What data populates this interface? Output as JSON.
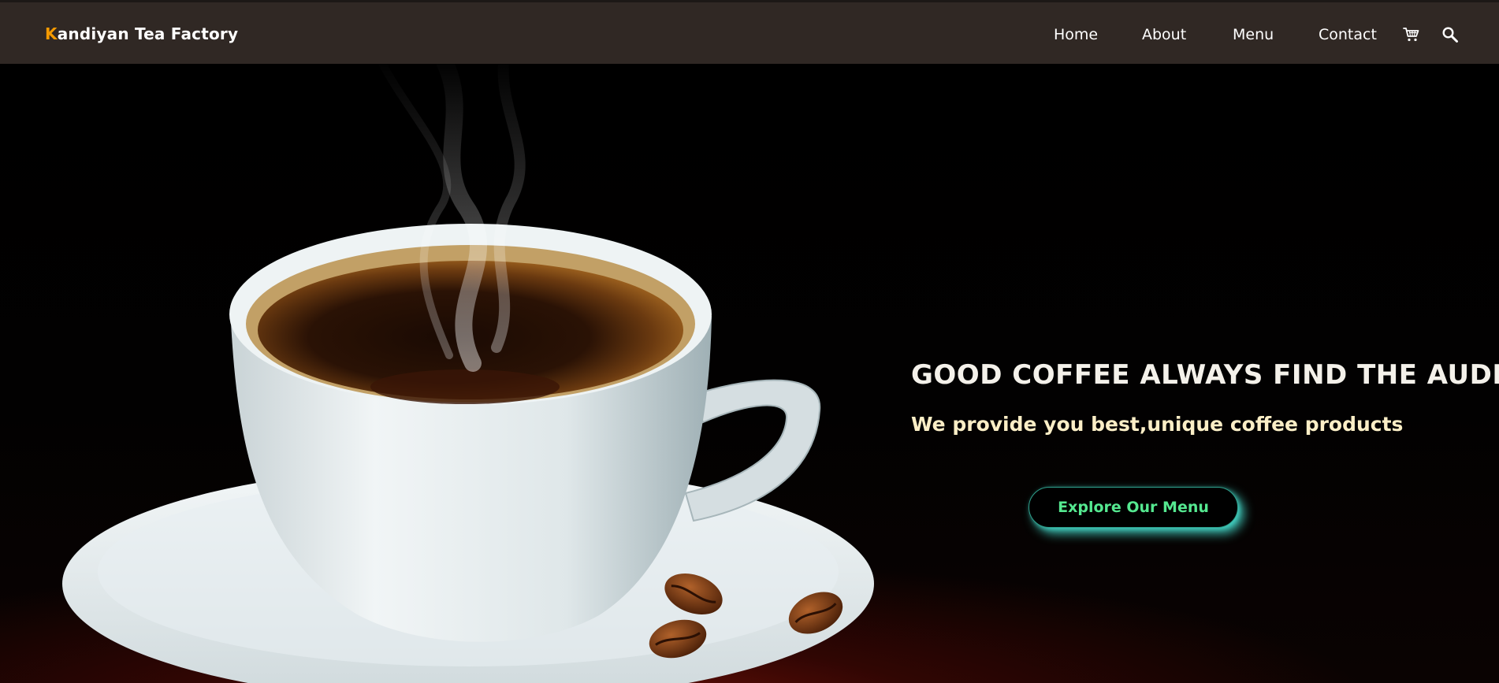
{
  "navbar": {
    "brand_first_letter": "K",
    "brand_rest": "andiyan Tea Factory",
    "links": [
      "Home",
      "About",
      "Menu",
      "Contact"
    ],
    "cart_icon": "cart-icon",
    "search_icon": "search-icon"
  },
  "hero": {
    "headline": "GOOD COFFEE ALWAYS FIND THE AUDIENCE.",
    "subline": "We provide you best,unique coffee products",
    "cta_label": "Explore Our Menu",
    "image_subject": "steaming white coffee cup on saucer with coffee beans"
  },
  "colors": {
    "navbar_bg": "#302824",
    "brand_accent": "#f59a00",
    "headline": "#f4f1ea",
    "subline": "#fbeec6",
    "cta_text": "#55e890",
    "cta_glow": "#48e2d2",
    "hero_bg": "#000000",
    "table_red": "#96160a"
  }
}
